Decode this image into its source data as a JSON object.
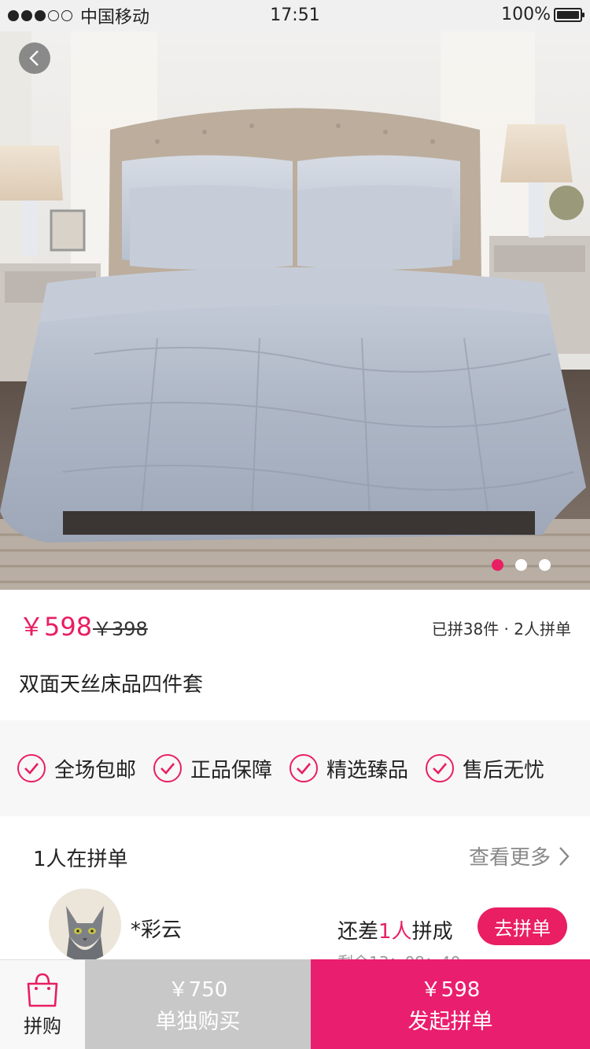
{
  "status_bar": {
    "carrier": "中国移动",
    "time": "17:51",
    "battery": "100%",
    "battery_level": 1.0,
    "signal_bars_filled": 3,
    "signal_bars_total": 5
  },
  "hero": {
    "image_subject": "bed",
    "pager": {
      "count": 3,
      "active_index": 0
    }
  },
  "product": {
    "price": "￥598",
    "original_price": "￥398",
    "group_info": "已拼38件 · 2人拼单",
    "title": "双面天丝床品四件套"
  },
  "guarantees": [
    {
      "label": "全场包邮",
      "icon": "check-circle-icon"
    },
    {
      "label": "正品保障",
      "icon": "check-circle-icon"
    },
    {
      "label": "精选臻品",
      "icon": "check-circle-icon"
    },
    {
      "label": "售后无忧",
      "icon": "check-circle-icon"
    }
  ],
  "group_section": {
    "title": "1人在拼单",
    "view_more": "查看更多",
    "member": {
      "name": "*彩云",
      "lack_prefix": "还差",
      "lack_count": "1人",
      "lack_suffix": "拼成",
      "countdown": "剩余13：08：40",
      "join_label": "去拼单"
    }
  },
  "bottom_bar": {
    "tab_label": "拼购",
    "solo_price": "￥750",
    "solo_label": "单独购买",
    "group_price": "￥598",
    "group_label": "发起拼单"
  },
  "colors": {
    "accent": "#e91e63",
    "bottom_group_bg": "#ea1e6e",
    "bottom_solo_bg": "#c8c8c8"
  }
}
